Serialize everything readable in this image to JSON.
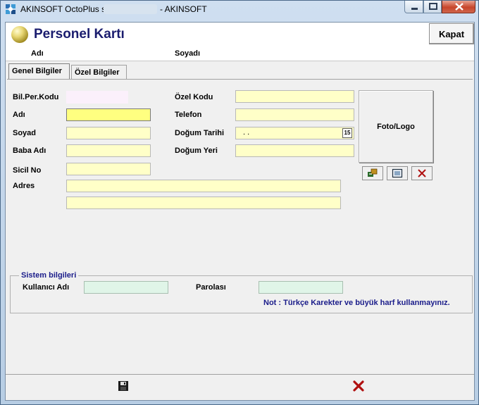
{
  "window": {
    "title_prefix": "AKINSOFT OctoPlus s",
    "title_suffix": "- AKINSOFT"
  },
  "header": {
    "title": "Personel Kartı",
    "close_label": "Kapat"
  },
  "subheader": {
    "name_label": "Adı",
    "surname_label": "Soyadı"
  },
  "tabs": [
    {
      "label": "Genel Bilgiler",
      "active": true
    },
    {
      "label": "Özel Bilgiler",
      "active": false
    }
  ],
  "form": {
    "bil_per_kodu": {
      "label": "Bil.Per.Kodu",
      "value": ""
    },
    "adi": {
      "label": "Adı",
      "value": ""
    },
    "soyad": {
      "label": "Soyad",
      "value": ""
    },
    "baba_adi": {
      "label": "Baba Adı",
      "value": ""
    },
    "sicil_no": {
      "label": "Sicil No",
      "value": ""
    },
    "adres": {
      "label": "Adres",
      "line1": "",
      "line2": ""
    },
    "ozel_kodu": {
      "label": "Özel Kodu",
      "value": ""
    },
    "telefon": {
      "label": "Telefon",
      "value": ""
    },
    "dogum_tarihi": {
      "label": "Doğum Tarihi",
      "value": ".  .",
      "calendar_label": "15"
    },
    "dogum_yeri": {
      "label": "Doğum Yeri",
      "value": ""
    }
  },
  "photo": {
    "label": "Foto/Logo",
    "icons": [
      "load-photo-icon",
      "view-photo-icon",
      "delete-photo-icon"
    ]
  },
  "system": {
    "group_title": "Sistem bilgileri",
    "username_label": "Kullanıcı Adı",
    "username_value": "",
    "password_label": "Parolası",
    "password_value": "",
    "note": "Not : Türkçe Karekter ve büyük harf kullanmayınız."
  },
  "footer": {
    "icons": [
      "save-icon",
      "cancel-icon"
    ]
  },
  "colors": {
    "title_navy": "#1a1c6e",
    "field_yellow": "#ffffc8",
    "field_focus": "#ffff80",
    "field_mint": "#e0f5e8",
    "cancel_red": "#b01010"
  }
}
